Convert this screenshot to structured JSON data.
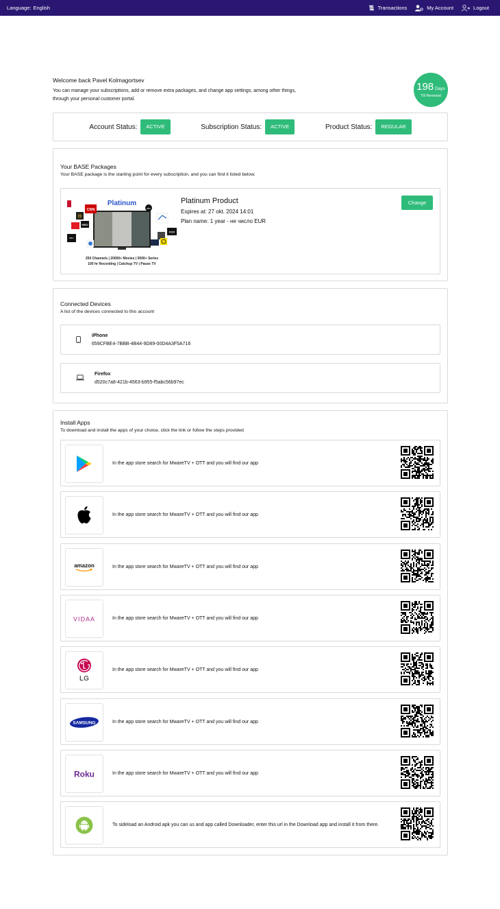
{
  "topbar": {
    "language_label": "Language:",
    "language_value": "English",
    "transactions": "Transactions",
    "my_account": "My Account",
    "logout": "Logout"
  },
  "welcome": {
    "greeting": "Welcome back Pavel Kolmagortsev",
    "line1": "You can manage your subscriptions, add or remove extra packages, and change app settings, among other things,",
    "line2": "through your personal customer portal."
  },
  "renewal": {
    "days": "198",
    "unit": "Days",
    "label": "Till Renewal"
  },
  "status": {
    "account_label": "Account Status:",
    "account_value": "ACTIVE",
    "subscription_label": "Subscription Status:",
    "subscription_value": "ACTIVE",
    "product_label": "Product Status:",
    "product_value": "REGULAR"
  },
  "packages": {
    "title": "Your BASE Packages",
    "description": "Your BASE package is the starting point for every subscription, and you can find it listed below.",
    "product_name": "Platinum Product",
    "expires": "Expires at: 27 okt. 2024 14:01",
    "plan": "Plan name: 1 year - не число EUR",
    "change_button": "Change",
    "image": {
      "title": "Platinum",
      "features_line1": "250 Channels  |  20000+ Movies  |  5000+ Series",
      "features_line2": "100 hr Recording  |  Catchup TV  |  Pause TV"
    }
  },
  "devices": {
    "title": "Connected Devices",
    "description": "A list of the devices connected to this account",
    "items": [
      {
        "name": "iPhone",
        "id": "659CFBE4-7BBB-4B44-9D89-00D4A3F5A716",
        "icon": "phone-icon"
      },
      {
        "name": "Firefox",
        "id": "d520c7a8-421b-4563-b955-f5abc56b97ec",
        "icon": "laptop-icon"
      }
    ]
  },
  "apps": {
    "title": "Install Apps",
    "description": "To download and install the apps of your choice, click the link or follow the steps provided",
    "store_text": "In the app store search for MwareTV + OTT and you will find our app",
    "sideload_text": "To sideload an Android apk you can us and app called Downloader, enter this url in the Download app and install it from there.",
    "logos": {
      "amazon": "amazon",
      "vidaa": "VIDAA",
      "lg": "LG",
      "samsung": "SAMSUNG",
      "roku": "Roku"
    }
  },
  "colors": {
    "topbar": "#2a1772",
    "accent": "#2fbc7a",
    "border": "#d9d9d9"
  }
}
